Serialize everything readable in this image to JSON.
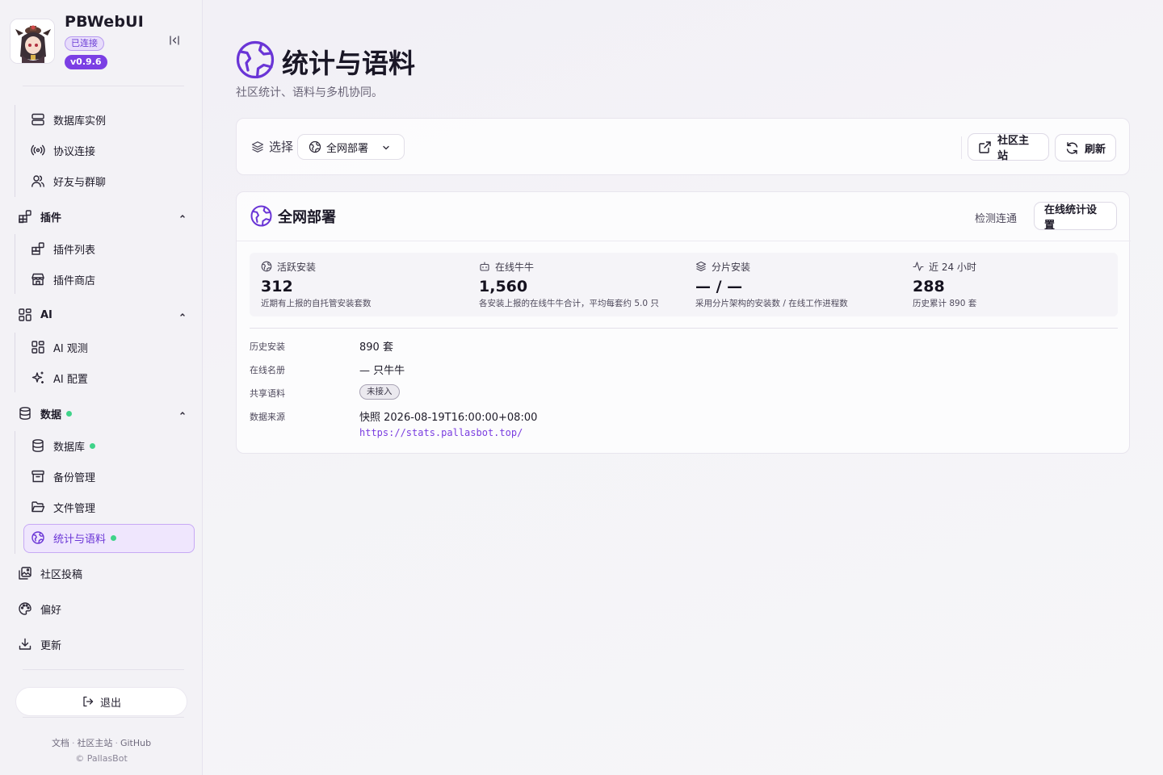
{
  "app": {
    "title": "PBWebUI",
    "status_badge": "已连接",
    "version": "v0.9.6"
  },
  "sidebar": {
    "items": [
      {
        "label": "数据库实例",
        "icon": "server-icon"
      },
      {
        "label": "协议连接",
        "icon": "broadcast-icon"
      },
      {
        "label": "好友与群聊",
        "icon": "users-icon"
      }
    ],
    "plugins": {
      "label": "插件",
      "icon": "blocks-icon",
      "items": [
        {
          "label": "插件列表",
          "icon": "blocks-icon"
        },
        {
          "label": "插件商店",
          "icon": "store-icon"
        }
      ]
    },
    "ai": {
      "label": "AI",
      "icon": "grid-icon",
      "items": [
        {
          "label": "AI 观测",
          "icon": "grid-icon"
        },
        {
          "label": "AI 配置",
          "icon": "sparkles-icon"
        }
      ]
    },
    "data": {
      "label": "数据",
      "icon": "database-icon",
      "items": [
        {
          "label": "数据库",
          "icon": "database-icon"
        },
        {
          "label": "备份管理",
          "icon": "archive-icon"
        },
        {
          "label": "文件管理",
          "icon": "folder-open-icon"
        },
        {
          "label": "统计与语料",
          "icon": "globe-icon"
        }
      ]
    },
    "community": {
      "label": "社区投稿",
      "icon": "image-plus-icon"
    },
    "preferences": {
      "label": "偏好",
      "icon": "palette-icon"
    },
    "update": {
      "label": "更新",
      "icon": "download-icon"
    },
    "logout": "退出",
    "footer": {
      "links": [
        "文档",
        "社区主站",
        "GitHub"
      ],
      "copyright": "© PallasBot"
    }
  },
  "page": {
    "title": "统计与语料",
    "subtitle": "社区统计、语料与多机协同。"
  },
  "toolbar": {
    "select_label": "选择",
    "select_value": "全网部署",
    "community_button": "社区主站",
    "refresh_button": "刷新"
  },
  "panel": {
    "title": "全网部署",
    "test_link": "检测连通",
    "settings_button": "在线统计设置",
    "stats": [
      {
        "label": "活跃安装",
        "value": "312",
        "desc": "近期有上报的自托管安装套数",
        "icon": "globe-icon"
      },
      {
        "label": "在线牛牛",
        "value": "1,560",
        "desc": "各安装上报的在线牛牛合计，平均每套约 5.0 只",
        "icon": "bot-icon"
      },
      {
        "label": "分片安装",
        "value": "— / —",
        "desc": "采用分片架构的安装数 / 在线工作进程数",
        "icon": "layers-icon"
      },
      {
        "label": "近 24 小时",
        "value": "288",
        "desc": "历史累计 890 套",
        "icon": "activity-icon"
      }
    ],
    "details": {
      "history_installs_label": "历史安装",
      "history_installs_value": "890 套",
      "online_roster_label": "在线名册",
      "online_roster_value": "— 只牛牛",
      "shared_corpus_label": "共享语料",
      "shared_corpus_value": "未接入",
      "data_source_label": "数据来源",
      "data_source_value": "快照 2026-08-19T16:00:00+08:00",
      "data_source_url": "https://stats.pallasbot.top/"
    }
  },
  "colors": {
    "accent": "#7b3fe4",
    "accent_light": "#efe6fd",
    "status_ok": "#3fd389"
  }
}
